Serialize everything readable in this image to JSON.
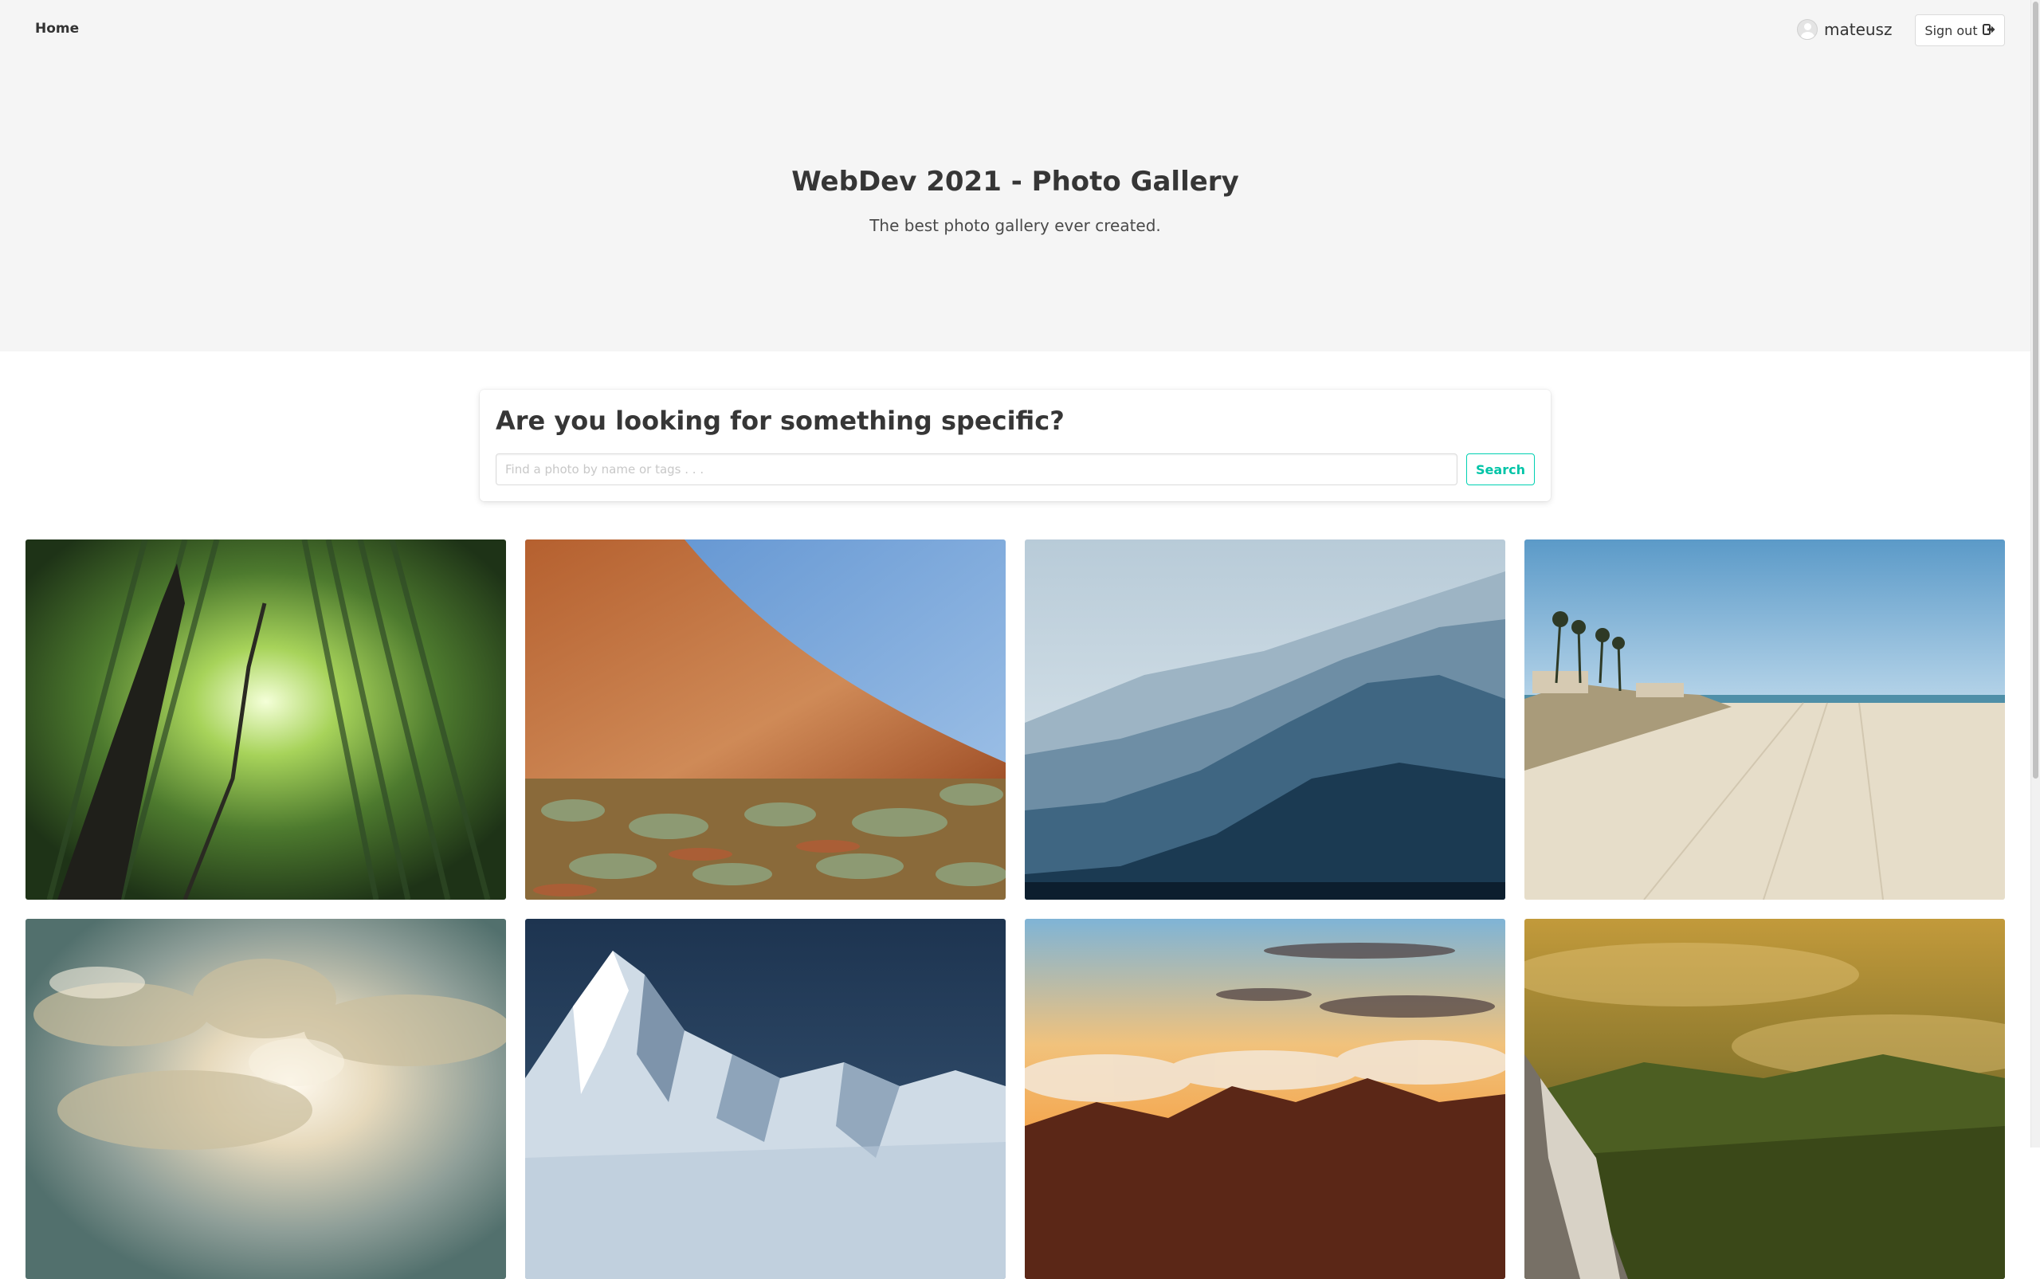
{
  "nav": {
    "home_label": "Home",
    "username": "mateusz",
    "signout_label": "Sign out"
  },
  "hero": {
    "title": "WebDev 2021 - Photo Gallery",
    "subtitle": "The best photo gallery ever created."
  },
  "search": {
    "heading": "Are you looking for something specific?",
    "placeholder": "Find a photo by name or tags . . .",
    "button_label": "Search"
  },
  "colors": {
    "accent": "#00d1b2",
    "hero_background": "#f5f5f5"
  },
  "gallery": {
    "photos": [
      "bamboo-forest-photo",
      "desert-rock-photo",
      "misty-mountains-photo",
      "sandy-beach-photo",
      "sunlit-clouds-photo",
      "snowy-peaks-photo",
      "sunset-clouds-photo",
      "forest-valley-photo"
    ]
  }
}
